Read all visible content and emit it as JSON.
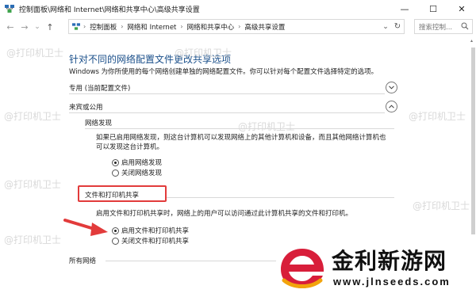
{
  "window": {
    "title": "控制面板\\网络和 Internet\\网络和共享中心\\高级共享设置",
    "controls": {
      "minimize": "—",
      "maximize": "☐",
      "close": "✕"
    }
  },
  "nav": {
    "back": "←",
    "forward": "→",
    "down": "⌄",
    "up": "↑",
    "breadcrumbs": [
      "控制面板",
      "网络和 Internet",
      "网络和共享中心",
      "高级共享设置"
    ],
    "search_placeholder": "搜索控制..."
  },
  "page": {
    "heading": "针对不同的网络配置文件更改共享选项",
    "description": "Windows 为你所使用的每个网络创建单独的网络配置文件。你可以针对每个配置文件选择特定的选项。",
    "sections": {
      "private": "专用 (当前配置文件)",
      "guest": "来宾或公用",
      "all": "所有网络"
    },
    "network_discovery": {
      "label": "网络发现",
      "text_line1": "如果已启用网络发现，则这台计算机可以发现网络上的其他计算机和设备，而且其他网络计算机也",
      "text_line2": "可以发现这台计算机。",
      "option_on": "启用网络发现",
      "option_off": "关闭网络发现"
    },
    "file_sharing": {
      "label": "文件和打印机共享",
      "text": "启用文件和打印机共享时，网络上的用户可以访问通过此计算机共享的文件和打印机。",
      "option_on": "启用文件和打印机共享",
      "option_off": "关闭文件和打印机共享"
    }
  },
  "watermarks": {
    "text": "@打印机卫士",
    "brand_cn": "金利新游网",
    "brand_url": "www.jlnseeds.com"
  },
  "colors": {
    "heading": "#1a4f8a",
    "highlight_box": "#e23b3b",
    "arrow": "#e23b3b"
  }
}
